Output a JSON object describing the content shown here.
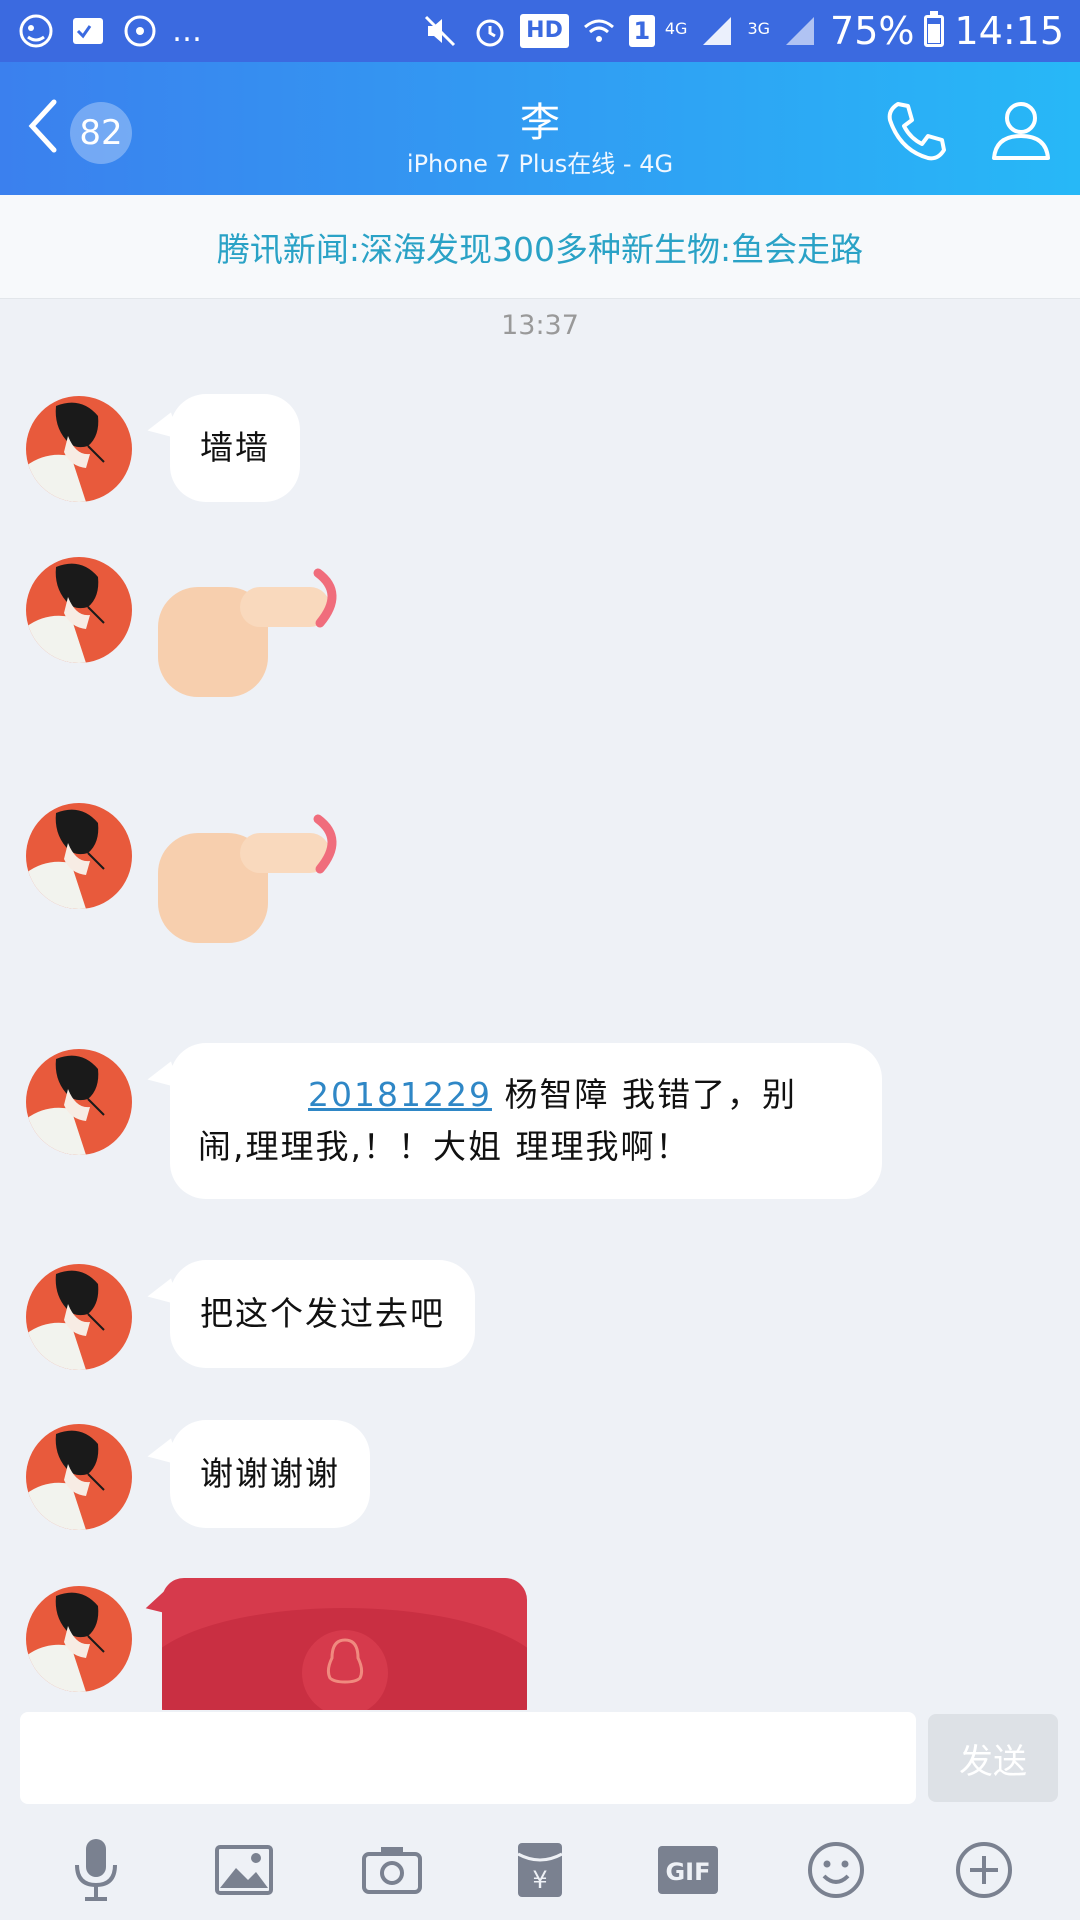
{
  "status_bar": {
    "network_4g": "4G",
    "network_3g": "3G",
    "hd": "HD",
    "sim": "1",
    "battery": "75%",
    "battery_level": 0.75,
    "time": "14:15"
  },
  "header": {
    "unread_count": "82",
    "title": "李",
    "subtitle": "iPhone 7 Plus在线 - 4G"
  },
  "news": "腾讯新闻:深海发现300多种新生物:鱼会走路",
  "timestamp": "13:37",
  "messages": [
    {
      "type": "text",
      "text": "墙墙"
    },
    {
      "type": "emoji",
      "icon": "pointing-finger-emoji"
    },
    {
      "type": "emoji",
      "icon": "pointing-finger-emoji"
    },
    {
      "type": "text",
      "link": "20181229",
      "line1": " 杨智障 我错了，别",
      "line2": "闹,理理我,！！大姐 理理我啊！"
    },
    {
      "type": "text",
      "text": "把这个发过去吧"
    },
    {
      "type": "text",
      "text": "谢谢谢谢"
    },
    {
      "type": "red-packet"
    }
  ],
  "input": {
    "placeholder": "",
    "send_label": "发送"
  },
  "toolbar": [
    "mic-icon",
    "image-icon",
    "camera-icon",
    "red-packet-icon",
    "gif-icon",
    "emoji-icon",
    "plus-icon"
  ],
  "gif_label": "GIF",
  "colors": {
    "header_start": "#3b80ee",
    "header_end": "#27b8f7",
    "news_text": "#2aa2c6",
    "red_packet": "#d63a4c"
  }
}
